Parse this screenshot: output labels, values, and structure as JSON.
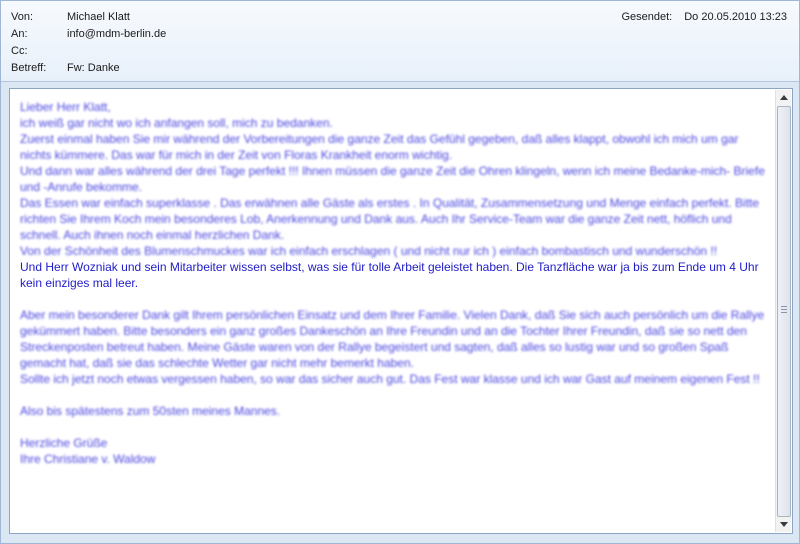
{
  "header": {
    "from_label": "Von:",
    "from_value": "Michael Klatt",
    "to_label": "An:",
    "to_value": "info@mdm-berlin.de",
    "cc_label": "Cc:",
    "cc_value": "",
    "subject_label": "Betreff:",
    "subject_value": "Fw: Danke",
    "sent_label": "Gesendet:",
    "sent_value": "Do 20.05.2010 13:23"
  },
  "message": {
    "blurred_1": [
      "Lieber Herr Klatt,",
      "ich weiß gar nicht wo ich anfangen soll, mich zu bedanken.",
      "Zuerst einmal haben Sie mir während der Vorbereitungen die ganze Zeit das Gefühl gegeben, daß alles klappt, obwohl ich mich um gar nichts kümmere. Das war für mich in der Zeit von Floras Krankheit enorm wichtig.",
      "Und dann war alles während der drei Tage perfekt !!! Ihnen müssen die ganze Zeit die Ohren klingeln, wenn ich meine Bedanke-mich- Briefe und -Anrufe bekomme.",
      "Das Essen war einfach superklasse . Das erwähnen alle Gäste als erstes . In Qualität, Zusammensetzung und Menge einfach perfekt. Bitte richten Sie Ihrem Koch mein besonderes Lob, Anerkennung und Dank aus. Auch Ihr Service-Team war die ganze Zeit nett, höflich und schnell. Auch ihnen noch einmal herzlichen Dank.",
      "Von der Schönheit des Blumenschmuckes war ich einfach erschlagen ( und nicht nur ich ) einfach bombastisch und wunderschön !!"
    ],
    "highlight": "Und Herr Wozniak und sein Mitarbeiter wissen selbst, was sie für tolle Arbeit geleistet haben. Die Tanzfläche war ja bis zum Ende um 4 Uhr kein einziges mal leer.",
    "blurred_2": [
      "Aber mein besonderer Dank gilt Ihrem persönlichen Einsatz und dem Ihrer Familie. Vielen Dank, daß Sie sich auch persönlich um die Rallye gekümmert haben. Bitte besonders ein ganz großes Dankeschön an Ihre Freundin und an die Tochter Ihrer Freundin, daß sie so nett den Streckenposten betreut haben. Meine Gäste waren von der Rallye begeistert und sagten, daß alles so lustig war und so großen Spaß gemacht hat, daß sie das schlechte Wetter gar nicht mehr bemerkt haben.",
      "Sollte ich jetzt noch etwas vergessen haben, so war das sicher auch gut. Das Fest war klasse und ich war Gast auf meinem eigenen Fest !!"
    ],
    "blurred_3": "Also bis spätestens zum 50sten meines Mannes.",
    "closing_1": "Herzliche Grüße",
    "closing_2": "Ihre Christiane v. Waldow"
  },
  "icons": {
    "scroll_up": "scroll-up-icon",
    "scroll_down": "scroll-down-icon"
  },
  "colors": {
    "body_text": "#1f1cc7",
    "header_bg": "#eef3fa"
  }
}
